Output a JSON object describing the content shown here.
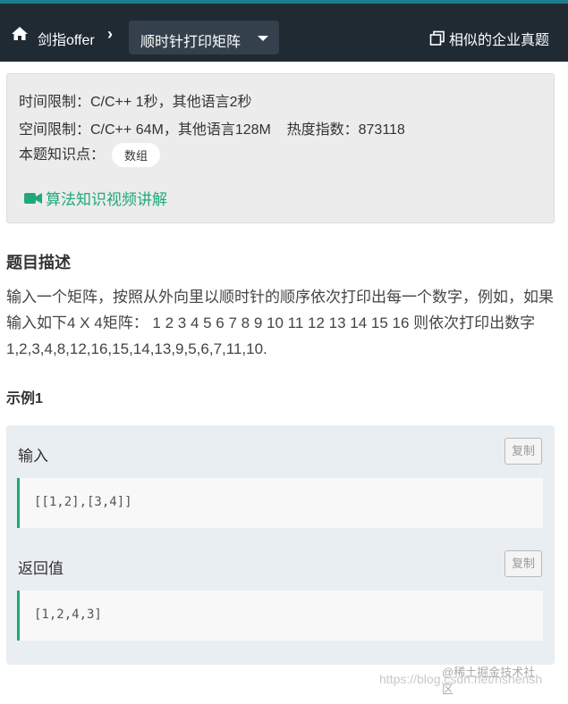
{
  "nav": {
    "home_icon": "home-icon",
    "breadcrumb": "剑指offer",
    "separator": "›",
    "dropdown_label": "顺时针打印矩阵",
    "similar_link": "相似的企业真题",
    "colors": {
      "bar": "#1f2a33",
      "accent": "#1c7f8d"
    }
  },
  "info": {
    "time_limit": "时间限制：C/C++ 1秒，其他语言2秒",
    "space_limit": "空间限制：C/C++ 64M，其他语言128M",
    "heat": "热度指数：873118",
    "knowledge_label": "本题知识点：",
    "tag": "数组",
    "video_link": "算法知识视频讲解",
    "video_color": "#1fa97b"
  },
  "problem": {
    "title": "题目描述",
    "description": "输入一个矩阵，按照从外向里以顺时针的顺序依次打印出每一个数字，例如，如果输入如下4 X 4矩阵： 1 2 3 4 5 6 7 8 9 10 11 12 13 14 15 16 则依次打印出数字1,2,3,4,8,12,16,15,14,13,9,5,6,7,11,10."
  },
  "example": {
    "title": "示例1",
    "input_label": "输入",
    "input_value": "[[1,2],[3,4]]",
    "output_label": "返回值",
    "output_value": "[1,2,4,3]",
    "copy_label": "复制"
  },
  "watermark": {
    "site": "@稀土掘金技术社区",
    "url": "https://blog.csdn.net/hshensh"
  }
}
